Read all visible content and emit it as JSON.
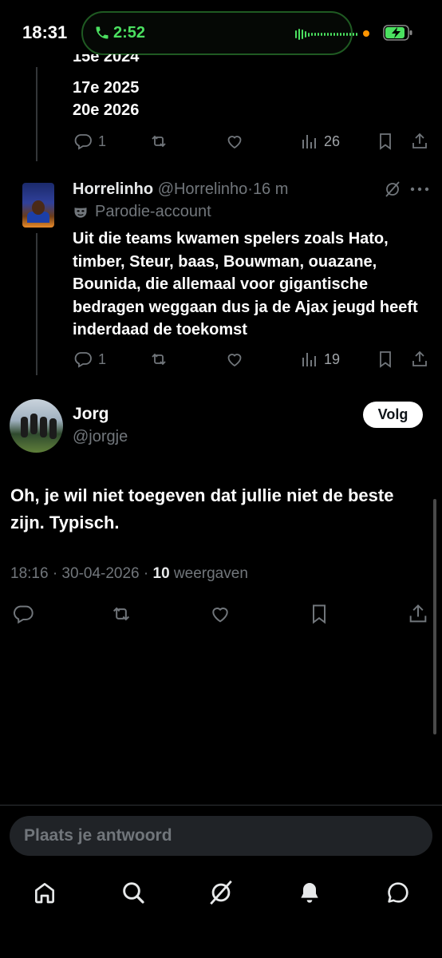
{
  "status_bar": {
    "time": "18:31",
    "call_duration": "2:52"
  },
  "previous_thread": {
    "partial_line": "15e 2024",
    "lines": [
      "17e 2025",
      "20e 2026"
    ],
    "replies": "1",
    "views": "26"
  },
  "thread_tweet": {
    "name": "Horrelinho",
    "handle": "@Horrelinho",
    "separator": "·",
    "time": "16 m",
    "badge": "Parodie-account",
    "text": "Uit die teams kwamen spelers zoals Hato, timber, Steur, baas, Bouwman, ouazane, Bounida, die allemaal voor gigantische bedragen weggaan dus ja de Ajax jeugd heeft inderdaad de toekomst",
    "replies": "1",
    "views": "19"
  },
  "main_tweet": {
    "name": "Jorg",
    "handle": "@jorgje",
    "follow_label": "Volg",
    "text": "Oh, je wil niet toegeven dat jullie niet de beste zijn. Typisch.",
    "timestamp": "18:16 · 30-04-2026 · ",
    "views_count": "10",
    "views_label": " weergaven"
  },
  "reply_input": {
    "placeholder": "Plaats je antwoord"
  },
  "bottom_nav": {
    "items": [
      "home-icon",
      "search-icon",
      "grok-icon",
      "notifications-icon",
      "messages-icon"
    ]
  },
  "colors": {
    "background": "#000000",
    "muted": "#71767b",
    "call_green": "#4be060"
  }
}
